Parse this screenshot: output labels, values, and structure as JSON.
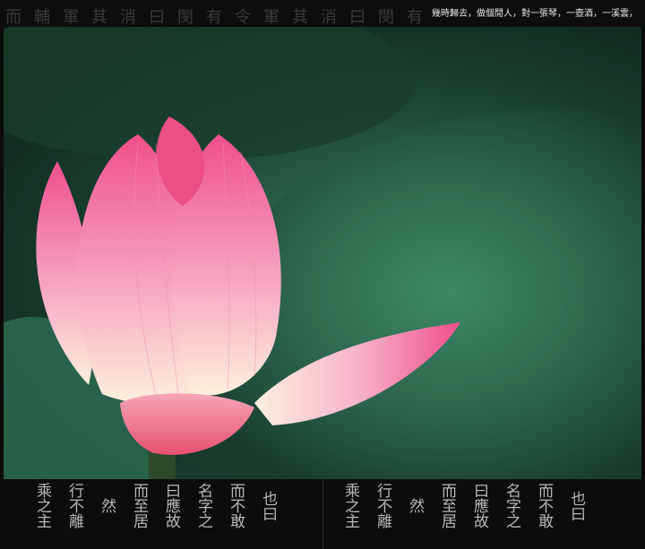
{
  "header": {
    "background_glyphs": "而輔軍其消曰閔有令軍其消曰閔有",
    "caption": "幾時歸去，做個閒人，對一張琴，一壺酒，一溪雲，"
  },
  "image": {
    "subject": "pink-lotus-bud",
    "colors": {
      "petal": "#f07aa8",
      "petal_light": "#fbe3ea",
      "leaf": "#2f6b52",
      "stem": "#2e4a2a"
    }
  },
  "footer": {
    "columns_left": [
      "乘之主",
      "行不離",
      "然",
      "而至居",
      "曰應故",
      "名字之",
      "而不敢",
      "也曰",
      "乘之主",
      "行不離",
      "然",
      "而至居",
      "曰應故",
      "名字之",
      "而不敢",
      "也曰"
    ]
  }
}
